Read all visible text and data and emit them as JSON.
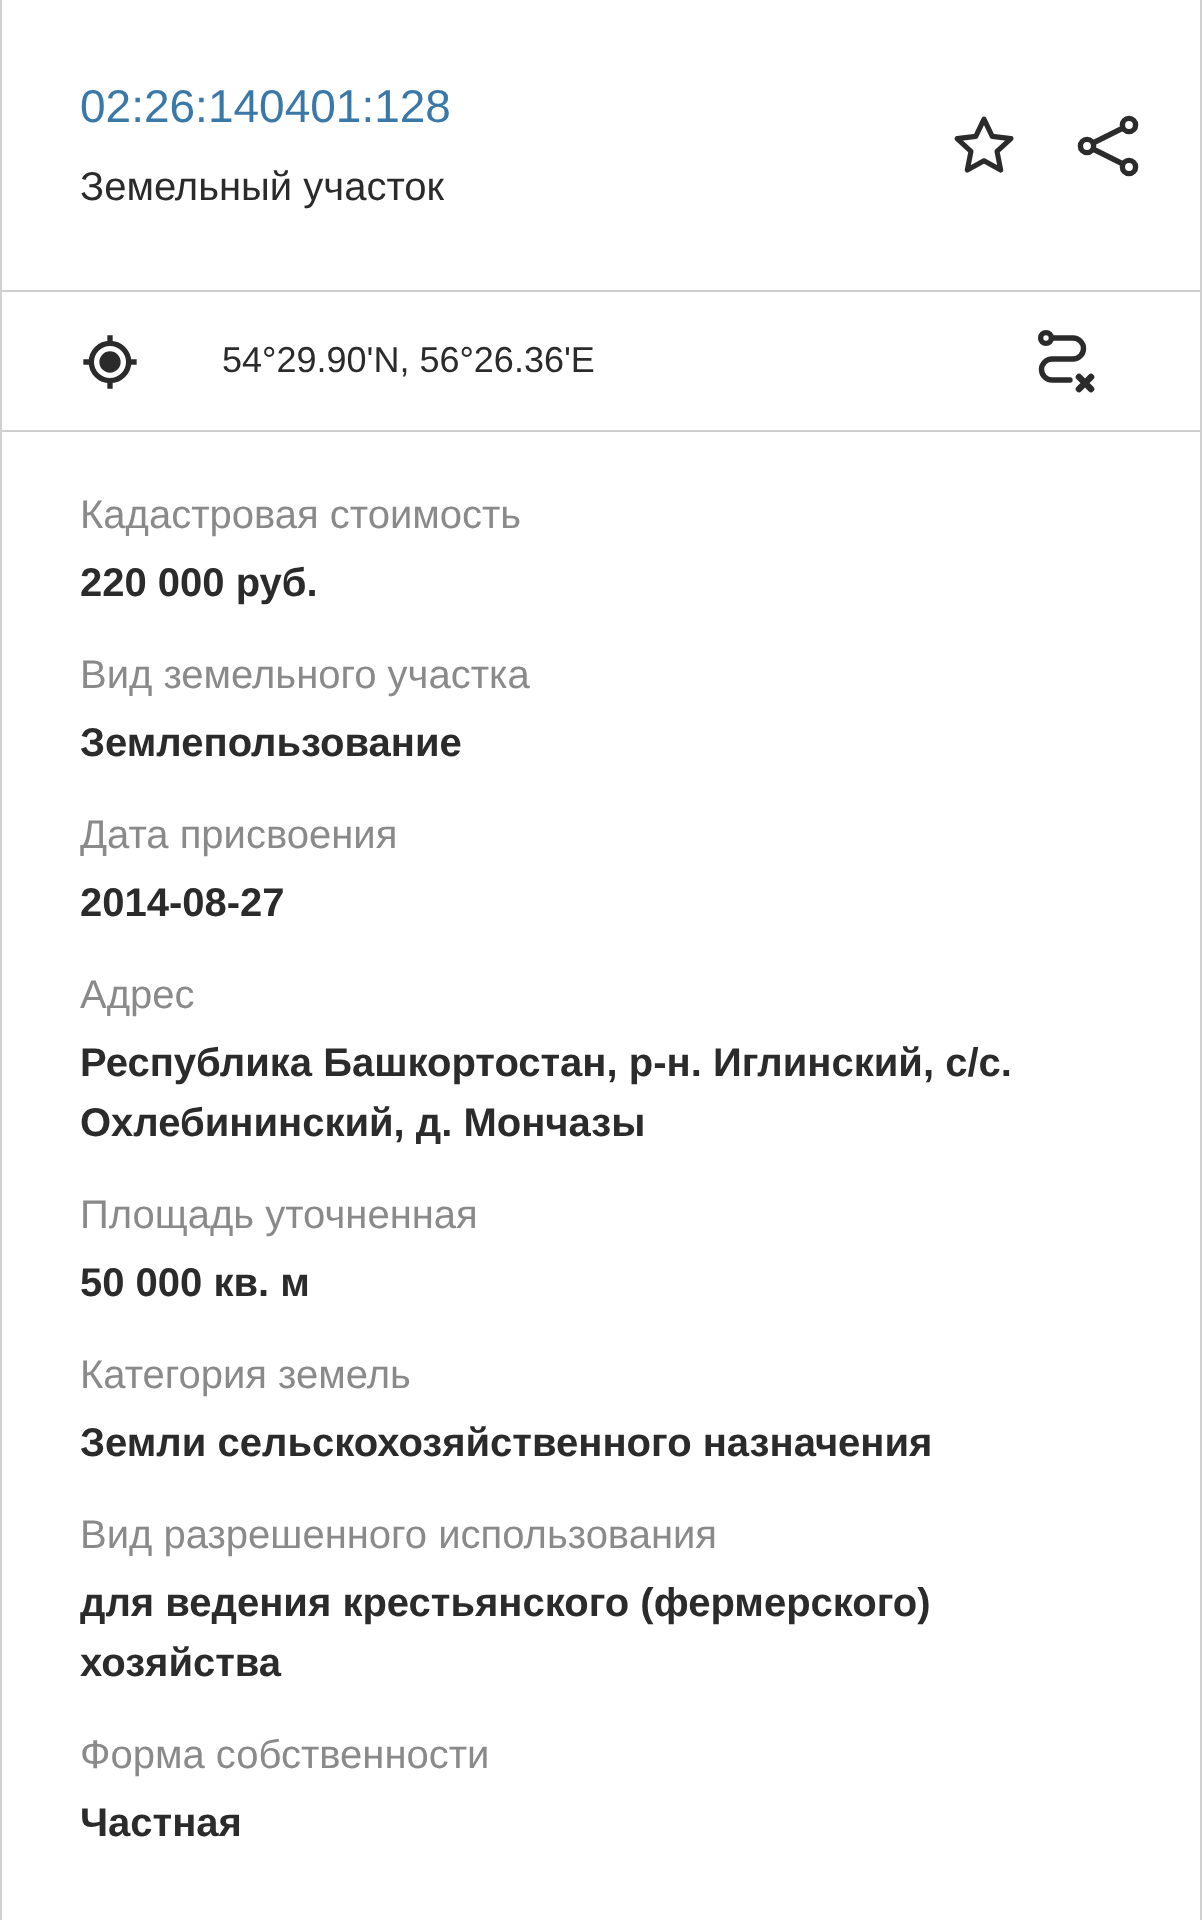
{
  "header": {
    "cadastral_number": "02:26:140401:128",
    "object_type": "Земельный участок"
  },
  "coordinates": "54°29.90'N, 56°26.36'E",
  "fields": [
    {
      "label": "Кадастровая стоимость",
      "value": "220 000 руб."
    },
    {
      "label": "Вид земельного участка",
      "value": "Землепользование"
    },
    {
      "label": "Дата присвоения",
      "value": "2014-08-27"
    },
    {
      "label": "Адрес",
      "value": "Республика Башкортостан, р-н. Иглинский, с/с. Охлебининский, д. Мончазы"
    },
    {
      "label": "Площадь уточненная",
      "value": "50 000 кв. м"
    },
    {
      "label": "Категория земель",
      "value": "Земли сельскохозяйственного назначения"
    },
    {
      "label": "Вид разрешенного использования",
      "value": "для ведения крестьянского (фермерского) хозяйства"
    },
    {
      "label": "Форма собственности",
      "value": "Частная"
    }
  ]
}
